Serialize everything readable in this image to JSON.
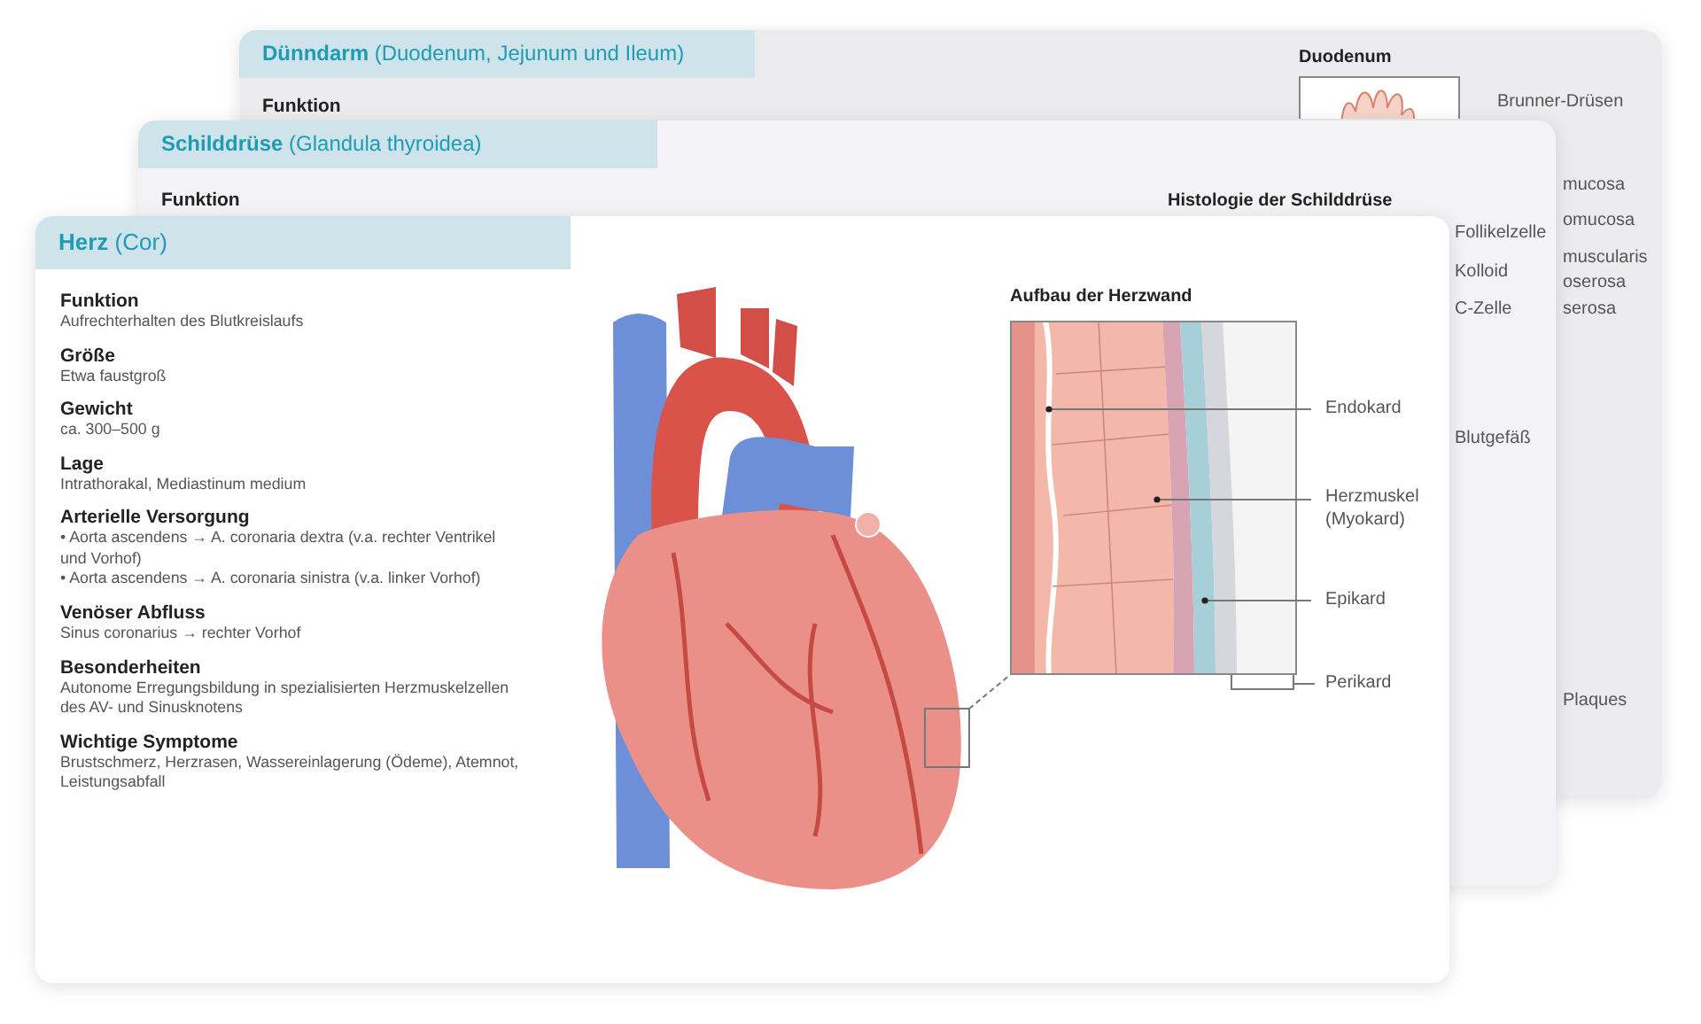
{
  "back_card": {
    "title": "**Dünndarm** (Duodenum, Jejunum und Ileum)",
    "section_heading": "Funktion",
    "figure_title": "Duodenum",
    "labels": [
      "Brunner-Drüsen",
      "mucosa",
      "omucosa",
      "muscularis",
      "oserosa",
      "serosa",
      "Plaques"
    ]
  },
  "middle_card": {
    "title": "**Schilddrüse** (Glandula thyroidea)",
    "section_heading": "Funktion",
    "figure_title": "Histologie der Schilddrüse",
    "labels": [
      "Follikelzelle",
      "Kolloid",
      "C-Zelle",
      "Blutgefäß"
    ]
  },
  "front_card": {
    "title": "**Herz** (Cor)",
    "sections": [
      {
        "heading": "Funktion",
        "lines": [
          "Aufrechterhalten des Blutkreislaufs"
        ]
      },
      {
        "heading": "Größe",
        "lines": [
          "Etwa faustgroß"
        ]
      },
      {
        "heading": "Gewicht",
        "lines": [
          "ca. 300–500 g"
        ]
      },
      {
        "heading": "Lage",
        "lines": [
          "Intrathorakal, Mediastinum medium"
        ]
      },
      {
        "heading": "Arterielle Versorgung",
        "lines": [
          "• Aorta ascendens → A. coronaria dextra (v.a. rechter Ventrikel und Vorhof)",
          "• Aorta ascendens → A. coronaria sinistra (v.a. linker Vorhof)"
        ]
      },
      {
        "heading": "Venöser Abfluss",
        "lines": [
          "Sinus coronarius → rechter Vorhof"
        ]
      },
      {
        "heading": "Besonderheiten",
        "lines": [
          "Autonome Erregungsbildung in spezialisierten Herzmuskelzellen des AV- und Sinusknotens"
        ]
      },
      {
        "heading": "Wichtige Symptome",
        "lines": [
          "Brustschmerz, Herzrasen, Wassereinlagerung (Ödeme), Atemnot, Leistungsabfall"
        ]
      }
    ],
    "wall_detail": {
      "title": "Aufbau der Herzwand",
      "labels": [
        {
          "text": "Endokard"
        },
        {
          "text": "Herzmuskel (Myokard)"
        },
        {
          "text": "Epikard"
        },
        {
          "text": "Perikard"
        }
      ]
    }
  }
}
